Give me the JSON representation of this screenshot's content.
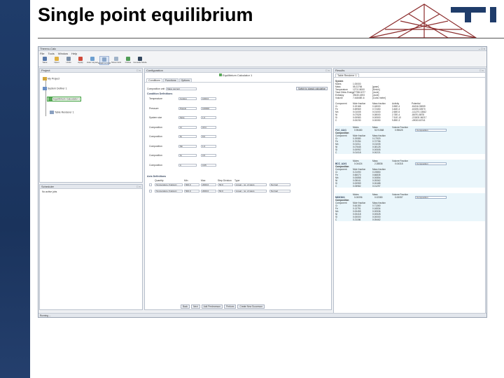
{
  "slide": {
    "title": "Single point equilibrium",
    "logo_text": "TI"
  },
  "app": {
    "window_title": "Thermo-Calc",
    "menu": [
      "File",
      "Tools",
      "Window",
      "Help"
    ],
    "toolbar": [
      "Save",
      "Open",
      "Undo",
      "Apply",
      "Auto Layout",
      "Graph to Grid",
      "Show Grid",
      "Online",
      "Console Mode"
    ],
    "project_pane": {
      "title": "Project",
      "nodes": [
        "My Project",
        "System Definer 1",
        "Equilibrium Calculator 1",
        "Table Renderer 1"
      ]
    },
    "scheduler_pane": {
      "title": "Scheduler",
      "item": "No active jobs"
    },
    "config_pane": {
      "title": "Configuration",
      "calc_name": "Equilibrium Calculator 1",
      "tabs": [
        "Conditions",
        "Functions",
        "Options"
      ],
      "calc_type_label": "Composition unit",
      "calc_type_value": "Mass percent",
      "switch_button": "Switch to classic calculation",
      "conditions_header": "Condition Definitions",
      "conditions": [
        {
          "label": "Temperature",
          "unit": "Celsius",
          "value": "1000.0"
        },
        {
          "label": "Pressure",
          "unit": "Pascal",
          "value": "100000"
        },
        {
          "label": "System size",
          "unit": "Mole",
          "value": "1.0"
        },
        {
          "label": "Composition",
          "unit": "Cr",
          "value": "18.0"
        },
        {
          "label": "Composition",
          "unit": "Ni",
          "value": "8.0"
        },
        {
          "label": "Composition",
          "unit": "Mn",
          "value": "1.0"
        },
        {
          "label": "Composition",
          "unit": "Si",
          "value": "0.5"
        },
        {
          "label": "Composition",
          "unit": "C",
          "value": "0.05"
        }
      ],
      "axis_header": "Axis Definitions",
      "axis_columns": [
        "Quantity",
        "Min",
        "Max",
        "Step Division",
        "Type"
      ],
      "axes": [
        {
          "quantity": "Temperature (Celsius)",
          "min": "500.0",
          "max": "2000.0",
          "step": "50.0",
          "type": "Linear - no. of steps",
          "mode": "Normal"
        },
        {
          "quantity": "Temperature (Celsius)",
          "min": "500.0",
          "max": "2000.0",
          "step": "50.0",
          "type": "Linear - no. of steps",
          "mode": "Normal"
        }
      ]
    },
    "bottom_bar": [
      "Back",
      "Next",
      "Add Predecessor",
      "Perform",
      "Create New Successor"
    ],
    "results_pane": {
      "title": "Results",
      "tab": "Table Renderer 1",
      "system_header": "System",
      "system": [
        [
          "Moles",
          "1.00000",
          ""
        ],
        [
          "Mass",
          "55.22784",
          "[gram]"
        ],
        [
          "Temperature",
          "1273.15000",
          "[Kelvin]"
        ],
        [
          "Total Gibbs Energy",
          "-77788.0077",
          "[Joule]"
        ],
        [
          "Enthalpy",
          "39430.4393",
          "[Joule]"
        ],
        [
          "Volume",
          "7.44845E-6",
          "[Cubic meter]"
        ]
      ],
      "component_columns": [
        "Component",
        "Mole fraction",
        "Mass fraction",
        "Activity",
        "Potential"
      ],
      "components": [
        [
          "Cr",
          "0.19168",
          "0.18000",
          "3.55E-4",
          "-84216.35059"
        ],
        [
          "Fe",
          "0.69969",
          "0.72450",
          "3.46E-3",
          "-60195.33970"
        ],
        [
          "Mn",
          "0.01005",
          "0.01000",
          "2.65E-5",
          "-111270.13542"
        ],
        [
          "Ni",
          "0.07528",
          "0.08000",
          "2.78E-4",
          "-86791.8878"
        ],
        [
          "Si",
          "0.00983",
          "0.00500",
          "7.51E-10",
          "-221831.56217"
        ],
        [
          "C",
          "0.00230",
          "0.00050",
          "9.89E-3",
          "-49033.63741"
        ]
      ],
      "phase_columns": [
        "",
        "Moles",
        "Mass",
        "Volume Fraction"
      ],
      "phases": [
        {
          "name": "FCC_A1#1",
          "moles": "0.95480",
          "mass": "52.91568",
          "vfrac": "0.95625",
          "sel": "Composition",
          "rows": [
            [
              "Cr",
              "0.19080",
              "0.17920"
            ],
            [
              "Fe",
              "0.70254",
              "0.72756"
            ],
            [
              "Mn",
              "0.01011",
              "0.01005"
            ],
            [
              "Ni",
              "0.07645",
              "0.08125"
            ],
            [
              "Si",
              "0.00992",
              "0.00505"
            ],
            [
              "C",
              "0.01018",
              "0.00221"
            ]
          ]
        },
        {
          "name": "BCC_A2#1",
          "moles": "0.04424",
          "mass": "2.28836",
          "vfrac": "0.04318",
          "sel": "Composition",
          "rows": [
            [
              "Cr",
              "0.21090",
              "0.19850"
            ],
            [
              "Fe",
              "0.66070",
              "0.66835"
            ],
            [
              "Mn",
              "0.00858",
              "0.00854"
            ],
            [
              "Ni",
              "0.05041",
              "0.05362"
            ],
            [
              "Si",
              "0.00959",
              "0.00488"
            ],
            [
              "C",
              "0.05982",
              "0.01297"
            ]
          ]
        },
        {
          "name": "M23C6#1",
          "moles": "0.00096",
          "mass": "0.02380",
          "vfrac": "0.00057",
          "sel": "Composition",
          "rows": [
            [
              "Cr",
              "0.64150",
              "0.71360"
            ],
            [
              "Fe",
              "0.13791",
              "0.16534"
            ],
            [
              "Mn",
              "0.00455",
              "0.00536"
            ],
            [
              "Ni",
              "0.00418",
              "0.00528"
            ],
            [
              "Si",
              "0.00000",
              "0.00000"
            ],
            [
              "C",
              "0.21186",
              "0.05462"
            ]
          ]
        }
      ]
    },
    "status": "Running ..."
  }
}
